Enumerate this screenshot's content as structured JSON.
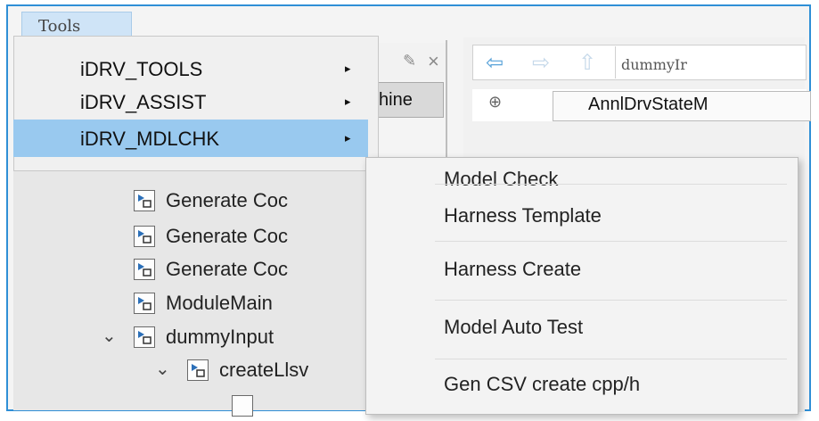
{
  "menubar": {
    "tools_label": "Tools"
  },
  "dropdown": {
    "items": [
      {
        "label": "iDRV_TOOLS",
        "arrow": "▸"
      },
      {
        "label": "iDRV_ASSIST",
        "arrow": "▸"
      },
      {
        "label": "iDRV_MDLCHK",
        "arrow": "▸"
      }
    ]
  },
  "submenu": {
    "items": [
      "Model Check",
      "Harness Template",
      "Harness Create",
      "Model Auto Test",
      "Gen CSV create cpp/h"
    ]
  },
  "tree": {
    "items": [
      {
        "label": "Generate Coc"
      },
      {
        "label": "Generate Coc"
      },
      {
        "label": "Generate Coc"
      },
      {
        "label": "ModuleMain"
      },
      {
        "label": "dummyInput",
        "chevron": "⌄"
      },
      {
        "label": "createLlsv",
        "chevron": "⌄"
      }
    ]
  },
  "background": {
    "tab_label": "hine",
    "path_text": "dummyIr",
    "address_text": "AnnlDrvStateM"
  },
  "colors": {
    "highlight": "#99c9ef",
    "frame_border": "#2f8fd6",
    "menubar_active": "#cfe4f7"
  }
}
